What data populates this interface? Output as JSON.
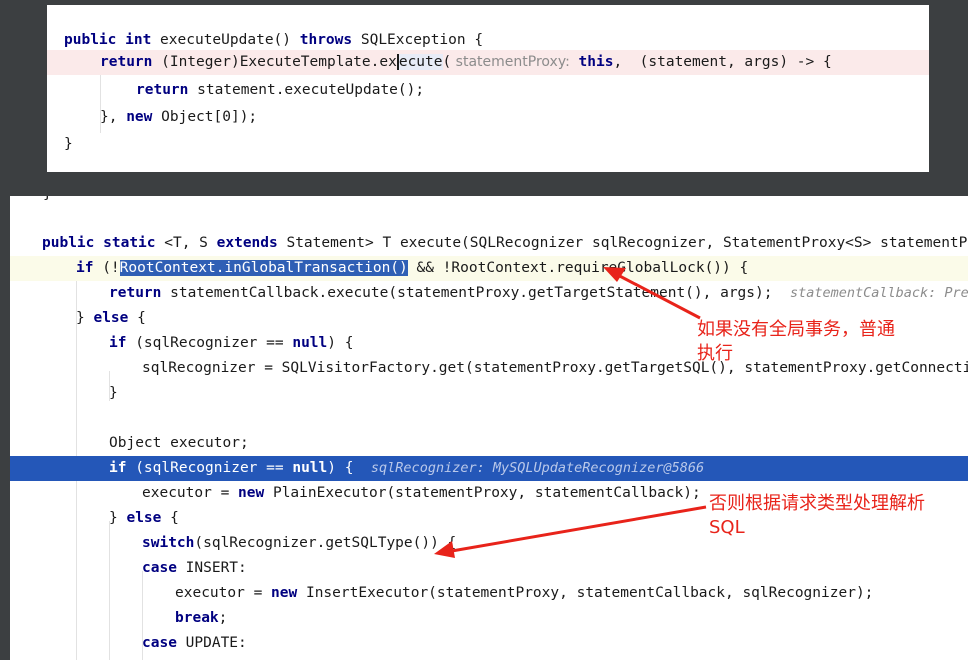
{
  "top_code": {
    "line1": {
      "kw1": "public",
      "kw2": "int",
      "t1": " executeUpdate() ",
      "kw3": "throws",
      "t2": " SQLException {"
    },
    "line2": {
      "kw1": "return",
      "t1": " (Integer)ExecuteTemplate.",
      "pre": "ex",
      "post": "ecute",
      "t2": "(",
      "hint": " statementProxy:",
      "kw2": "this",
      "t3": ",  (statement, args) -> {"
    },
    "line3": {
      "kw1": "return",
      "t1": " statement.executeUpdate();"
    },
    "line4": {
      "t1": "}, ",
      "kw1": "new",
      "t2": " Object[0]);"
    },
    "line5": {
      "t1": "}"
    }
  },
  "bottom_code": {
    "line0": {
      "t1": "}"
    },
    "line1": {
      "kw1": "public",
      "kw2": "static",
      "t1": " <T, S ",
      "kw3": "extends",
      "t2": " Statement> T execute(SQLRecognizer sqlRecognizer, StatementProxy<S> statementProxy,"
    },
    "line2": {
      "kw1": "if",
      "t1": " (!",
      "sel": "RootContext.inGlobalTransaction()",
      "t2": " && !RootContext.requireGlobalLock()) {"
    },
    "line3": {
      "kw1": "return",
      "t1": " statementCallback.execute(statementProxy.getTargetStatement(), args);  ",
      "hint": "statementCallback: Prepar"
    },
    "line4": {
      "t1": "} ",
      "kw1": "else",
      "t2": " {"
    },
    "line5": {
      "kw1": "if",
      "t1": " (sqlRecognizer == ",
      "kw2": "null",
      "t2": ") {"
    },
    "line6": {
      "t1": "sqlRecognizer = SQLVisitorFactory.get(statementProxy.getTargetSQL(), statementProxy.getConnectionPr"
    },
    "line7": {
      "t1": "}"
    },
    "line8": {
      "t1": ""
    },
    "line9": {
      "t1": "Object executor;"
    },
    "line10": {
      "kw1": "if",
      "t1": " (sqlRecognizer == ",
      "kw2": "null",
      "t2": ") {  ",
      "hint": "sqlRecognizer: MySQLUpdateRecognizer@5866"
    },
    "line11": {
      "t1": "executor = ",
      "kw1": "new",
      "t2": " PlainExecutor(statementProxy, statementCallback);"
    },
    "line12": {
      "t1": "} ",
      "kw1": "else",
      "t2": " {"
    },
    "line13": {
      "kw1": "switch",
      "t1": "(sqlRecognizer.getSQLType()) {"
    },
    "line14": {
      "kw1": "case",
      "t1": " INSERT:"
    },
    "line15": {
      "t1": "executor = ",
      "kw1": "new",
      "t2": " InsertExecutor(statementProxy, statementCallback, sqlRecognizer);"
    },
    "line16": {
      "kw1": "break",
      "t1": ";"
    },
    "line17": {
      "kw1": "case",
      "t1": " UPDATE:"
    }
  },
  "annotations": {
    "first": "如果没有全局事务，普通\n执行",
    "second": "否则根据请求类型处理解析\nSQL"
  },
  "colors": {
    "annotation": "#e8231a",
    "keyword": "#000080",
    "selection": "#2457b8"
  }
}
